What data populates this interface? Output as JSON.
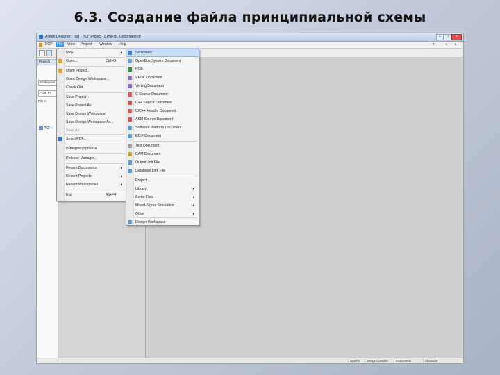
{
  "slide_title": "6.3. Создание файла принципиальной схемы",
  "window": {
    "title": "Altium Designer (Tss) - PCI_Project_1.PrjPcb. Unconnected",
    "min_glyph": "–",
    "max_glyph": "□",
    "close_glyph": "×"
  },
  "menubar": {
    "items": [
      "DXP",
      "File",
      "View",
      "Project",
      "Window",
      "Help"
    ],
    "right_glyphs": [
      "▾",
      "◂",
      "▸"
    ]
  },
  "left_panel": {
    "tab": "Projects",
    "field1": "Workspace",
    "field2": "PCB_Pr",
    "option": "File V",
    "tree_node": "PC"
  },
  "file_menu": {
    "items": [
      {
        "label": "New",
        "shortcut": "",
        "arrow": "▸",
        "icon": ""
      },
      {
        "label": "Open...",
        "shortcut": "Ctrl+O",
        "arrow": "",
        "icon": "#d8a93a"
      },
      {
        "label": "Open Project...",
        "shortcut": "",
        "arrow": "",
        "icon": "#d8a93a"
      },
      {
        "label": "Open Design Workspace...",
        "shortcut": "",
        "arrow": "",
        "icon": ""
      },
      {
        "label": "Check Out...",
        "shortcut": "",
        "arrow": "",
        "icon": ""
      },
      {
        "label": "Save Project",
        "shortcut": "",
        "arrow": "",
        "icon": ""
      },
      {
        "label": "Save Project As...",
        "shortcut": "",
        "arrow": "",
        "icon": ""
      },
      {
        "label": "Save Design Workspace",
        "shortcut": "",
        "arrow": "",
        "icon": ""
      },
      {
        "label": "Save Design Workspace As...",
        "shortcut": "",
        "arrow": "",
        "icon": ""
      },
      {
        "label": "Save All",
        "shortcut": "",
        "arrow": "",
        "icon": ""
      },
      {
        "label": "Smart PDF...",
        "shortcut": "",
        "arrow": "",
        "icon": "#3a6fc4"
      },
      {
        "label": "Импортер проекта",
        "shortcut": "",
        "arrow": "",
        "icon": ""
      },
      {
        "label": "Release Manager...",
        "shortcut": "",
        "arrow": "",
        "icon": ""
      },
      {
        "label": "Recent Documents",
        "shortcut": "",
        "arrow": "▸",
        "icon": ""
      },
      {
        "label": "Recent Projects",
        "shortcut": "",
        "arrow": "▸",
        "icon": ""
      },
      {
        "label": "Recent Workspaces",
        "shortcut": "",
        "arrow": "▸",
        "icon": ""
      },
      {
        "label": "Exit",
        "shortcut": "Alt+F4",
        "arrow": "",
        "icon": ""
      }
    ]
  },
  "new_menu": {
    "items": [
      {
        "label": "Schematic",
        "arrow": "",
        "icon": "#4b7fc9"
      },
      {
        "label": "OpenBus System Document",
        "arrow": "",
        "icon": "#6a9ad8"
      },
      {
        "label": "PCB",
        "arrow": "",
        "icon": "#3a8a3a"
      },
      {
        "label": "VHDL Document",
        "arrow": "",
        "icon": "#8a6ac8"
      },
      {
        "label": "Verilog Document",
        "arrow": "",
        "icon": "#8a6ac8"
      },
      {
        "label": "C Source Document",
        "arrow": "",
        "icon": "#c85a5a"
      },
      {
        "label": "C++ Source Document",
        "arrow": "",
        "icon": "#c85a5a"
      },
      {
        "label": "C/C++ Header Document",
        "arrow": "",
        "icon": "#c85a5a"
      },
      {
        "label": "ASM Source Document",
        "arrow": "",
        "icon": "#c85a5a"
      },
      {
        "label": "Software Platform Document",
        "arrow": "",
        "icon": "#5a9ac8"
      },
      {
        "label": "EDIF Document",
        "arrow": "",
        "icon": "#5a9ac8"
      },
      {
        "label": "Text Document",
        "arrow": "",
        "icon": "#9a9a9a"
      },
      {
        "label": "CAM Document",
        "arrow": "",
        "icon": "#c8a03a"
      },
      {
        "label": "Output Job File",
        "arrow": "",
        "icon": "#5a9ac8"
      },
      {
        "label": "Database Link File",
        "arrow": "",
        "icon": "#5a9ac8"
      },
      {
        "label": "Project...",
        "arrow": "",
        "icon": ""
      },
      {
        "label": "Library",
        "arrow": "▸",
        "icon": ""
      },
      {
        "label": "Script Files",
        "arrow": "▸",
        "icon": ""
      },
      {
        "label": "Mixed-Signal Simulation",
        "arrow": "▸",
        "icon": ""
      },
      {
        "label": "Other",
        "arrow": "▸",
        "icon": ""
      },
      {
        "label": "Design Workspace",
        "arrow": "",
        "icon": "#5a9ac8"
      }
    ]
  },
  "status_bar": {
    "items": [
      "System",
      "Design Compiler",
      "Instruments",
      "Shortcuts"
    ]
  }
}
